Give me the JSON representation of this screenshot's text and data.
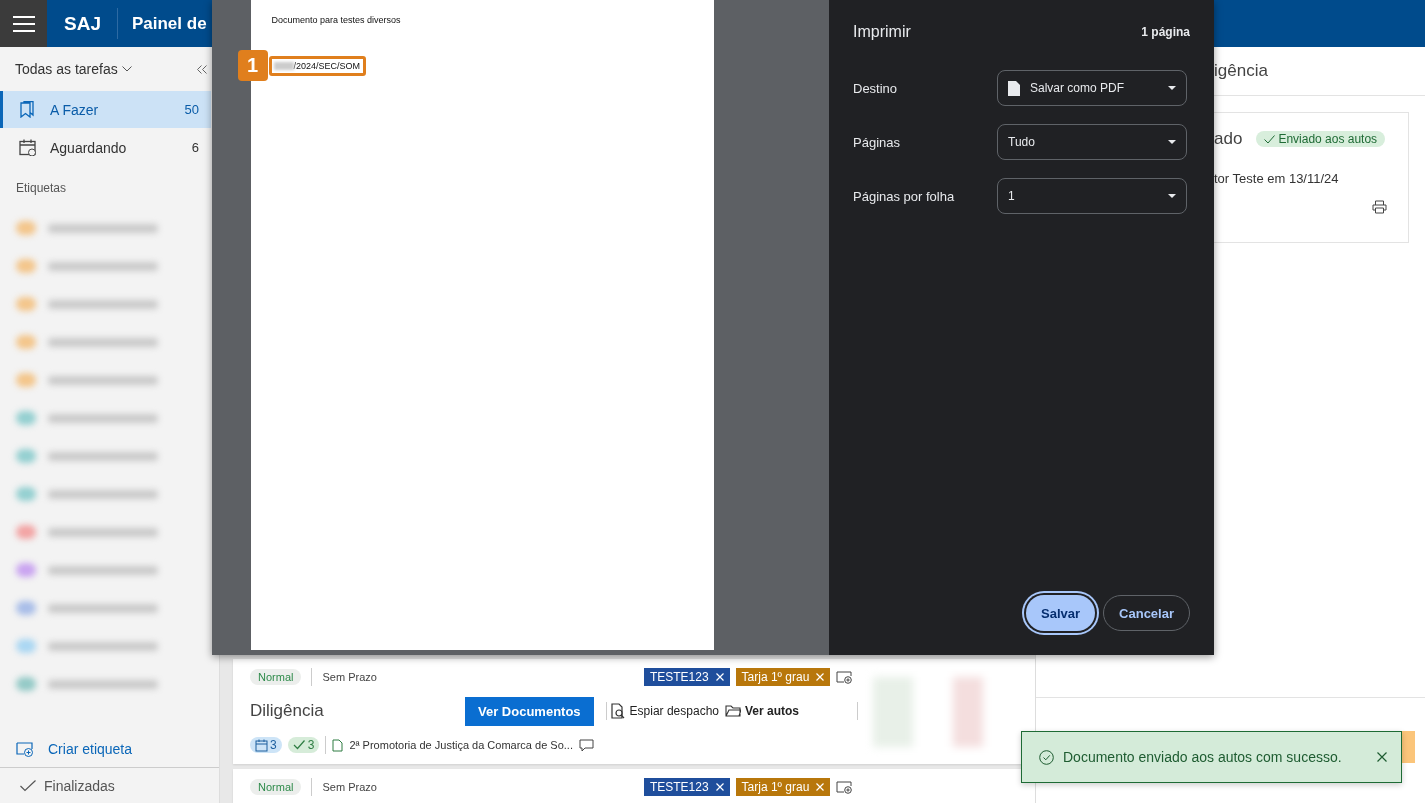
{
  "header": {
    "app_name": "SAJ",
    "title": "Painel de"
  },
  "sidebar": {
    "filter": "Todas as tarefas",
    "items": [
      {
        "label": "A Fazer",
        "count": "50",
        "selected": true,
        "kind": "bookmark"
      },
      {
        "label": "Aguardando",
        "count": "6",
        "selected": false,
        "kind": "calendar"
      }
    ],
    "section_label": "Etiquetas",
    "blurred_labels": [
      {
        "color": "#f3c58a"
      },
      {
        "color": "#f3c58a"
      },
      {
        "color": "#f3c58a"
      },
      {
        "color": "#f3c58a"
      },
      {
        "color": "#f3c58a"
      },
      {
        "color": "#93cfd0"
      },
      {
        "color": "#93cfd0"
      },
      {
        "color": "#93cfd0"
      },
      {
        "color": "#f2a3a3"
      },
      {
        "color": "#c9a3f0"
      },
      {
        "color": "#a8bde8"
      },
      {
        "color": "#a9d6f2"
      },
      {
        "color": "#93c9c6"
      }
    ],
    "create_label": "Criar etiqueta",
    "finished": "Finalizadas"
  },
  "print_dialog": {
    "title": "Imprimir",
    "page_count": "1 página",
    "preview": {
      "text": "Documento para testes diversos",
      "reference": "/2024/SEC/SOM",
      "callout": "1"
    },
    "settings": [
      {
        "label": "Destino",
        "value": "Salvar como PDF",
        "kind": "file"
      },
      {
        "label": "Páginas",
        "value": "Tudo",
        "kind": "plain"
      },
      {
        "label": "Páginas por folha",
        "value": "1",
        "kind": "plain"
      }
    ],
    "buttons": [
      {
        "label": "Salvar",
        "kind": "primary"
      },
      {
        "label": "Cancelar",
        "kind": "secondary"
      }
    ]
  },
  "tasks": [
    {
      "priority": "Normal",
      "deadline": "Sem Prazo",
      "tags": [
        {
          "label": "TESTE123",
          "color": "#1f4e9c"
        },
        {
          "label": "Tarja 1º grau",
          "color": "#b8770b"
        }
      ],
      "title": "Diligência",
      "primary_action": "Ver Documentos",
      "actions": [
        {
          "label": "Espiar despacho",
          "kind": "peek"
        },
        {
          "label": "Ver autos",
          "kind": "folder"
        }
      ],
      "counters": [
        {
          "kind": "calendar",
          "value": "3"
        },
        {
          "kind": "check",
          "value": "3"
        }
      ],
      "origin": "2ª Promotoria de Justiça da Comarca de So..."
    },
    {
      "priority": "Normal",
      "deadline": "Sem Prazo",
      "tags": [
        {
          "label": "TESTE123",
          "color": "#1f4e9c"
        },
        {
          "label": "Tarja 1º grau",
          "color": "#b8770b"
        }
      ]
    }
  ],
  "detail": {
    "title": "igência",
    "heading": "ado",
    "status": "Enviado aos autos",
    "author_line": "tor Teste em 13/11/24"
  },
  "toast": {
    "message": "Documento enviado aos autos com sucesso."
  }
}
